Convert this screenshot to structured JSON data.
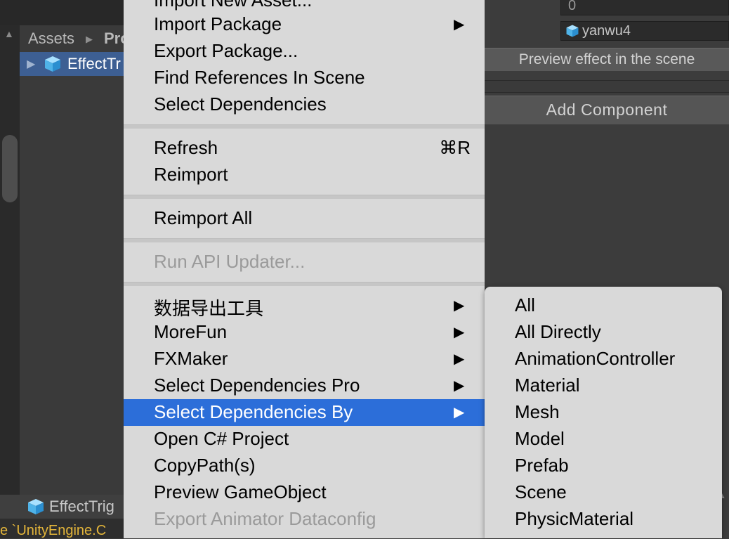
{
  "project": {
    "breadcrumb": [
      "Assets",
      "Pro"
    ],
    "selected_asset": "EffectTr",
    "bottom_asset": "EffectTrig",
    "console": "e `UnityEngine.C"
  },
  "inspector": {
    "int_value": "0",
    "object_value": "yanwu4",
    "preview_button": "Preview effect in the scene",
    "add_component_button": "Add Component"
  },
  "menu": {
    "items_top": [
      {
        "label": "Import New Asset...",
        "arrow": ""
      },
      {
        "label": "Import Package",
        "arrow": "▶"
      },
      {
        "label": "Export Package...",
        "arrow": ""
      },
      {
        "label": "Find References In Scene",
        "arrow": ""
      },
      {
        "label": "Select Dependencies",
        "arrow": ""
      }
    ],
    "refresh": {
      "label": "Refresh",
      "shortcut": "⌘R"
    },
    "reimport": "Reimport",
    "reimport_all": "Reimport All",
    "run_api_updater": "Run API Updater...",
    "items_bottom": [
      {
        "label": "数据导出工具",
        "arrow": "▶"
      },
      {
        "label": "MoreFun",
        "arrow": "▶"
      },
      {
        "label": "FXMaker",
        "arrow": "▶"
      },
      {
        "label": "Select Dependencies Pro",
        "arrow": "▶"
      },
      {
        "label": "Select Dependencies By",
        "arrow": "▶"
      },
      {
        "label": "Open C# Project",
        "arrow": ""
      },
      {
        "label": "CopyPath(s)",
        "arrow": ""
      },
      {
        "label": "Preview GameObject",
        "arrow": ""
      },
      {
        "label": "Export Animator Dataconfig",
        "arrow": ""
      }
    ],
    "highlighted": "Select Dependencies By"
  },
  "submenu": {
    "items": [
      "All",
      "All Directly",
      "AnimationController",
      "Material",
      "Mesh",
      "Model",
      "Prefab",
      "Scene",
      "PhysicMaterial"
    ]
  },
  "colors": {
    "menu_bg": "#d9d9d9",
    "highlight": "#2c6ed9",
    "selection_row": "#3d5f93",
    "console_text": "#e3b53a"
  }
}
